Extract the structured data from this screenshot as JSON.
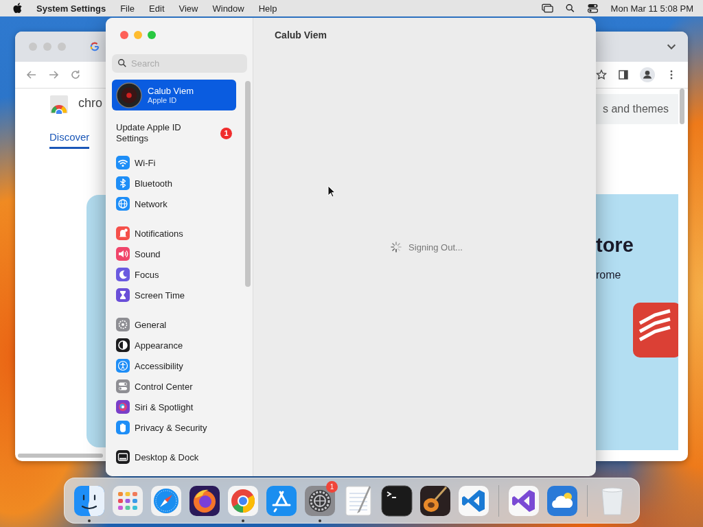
{
  "menu_bar": {
    "app_name": "System Settings",
    "menus": [
      "File",
      "Edit",
      "View",
      "Window",
      "Help"
    ],
    "clock": "Mon Mar 11  5:08 PM"
  },
  "browser_window": {
    "site_name": "chro",
    "tabs": [
      {
        "label": "Discover",
        "selected": true
      }
    ],
    "category_bar": "s and themes",
    "banner_title": "tore",
    "banner_subtitle": "rome"
  },
  "settings_window": {
    "search": {
      "placeholder": "Search"
    },
    "account": {
      "name": "Calub Viem",
      "subtitle": "Apple ID",
      "selected": true
    },
    "update": {
      "label": "Update Apple ID Settings",
      "badge": "1"
    },
    "groups": [
      [
        {
          "label": "Wi-Fi",
          "color": "#1e8ef7",
          "selected": false
        },
        {
          "label": "Bluetooth",
          "color": "#1e8ef7",
          "selected": false
        },
        {
          "label": "Network",
          "color": "#1e8ef7",
          "selected": false
        }
      ],
      [
        {
          "label": "Notifications",
          "color": "#f5504a",
          "selected": false
        },
        {
          "label": "Sound",
          "color": "#f0456a",
          "selected": false
        },
        {
          "label": "Focus",
          "color": "#6a5ae0",
          "selected": false
        },
        {
          "label": "Screen Time",
          "color": "#6a4fd8",
          "selected": false
        }
      ],
      [
        {
          "label": "General",
          "color": "#8e8e93",
          "selected": false
        },
        {
          "label": "Appearance",
          "color": "#1c1c1e",
          "selected": false
        },
        {
          "label": "Accessibility",
          "color": "#1e8ef7",
          "selected": false
        },
        {
          "label": "Control Center",
          "color": "#8e8e93",
          "selected": false
        },
        {
          "label": "Siri & Spotlight",
          "color": "#7a3fc8",
          "selected": false
        },
        {
          "label": "Privacy & Security",
          "color": "#1e8ef7",
          "selected": false
        }
      ],
      [
        {
          "label": "Desktop & Dock",
          "color": "#1c1c1e",
          "selected": false
        }
      ]
    ],
    "title": "Calub Viem",
    "status": "Signing Out..."
  },
  "dock": {
    "sections": [
      [
        {
          "running": true
        },
        {
          "running": false
        },
        {
          "running": false
        },
        {
          "running": false
        },
        {
          "running": true
        },
        {
          "running": false
        },
        {
          "running": true,
          "badge": "1"
        },
        {
          "running": false
        },
        {
          "running": false
        },
        {
          "running": false
        },
        {
          "running": false
        }
      ],
      [
        {
          "running": false
        },
        {
          "running": false
        }
      ],
      [
        {
          "running": false
        }
      ]
    ]
  }
}
